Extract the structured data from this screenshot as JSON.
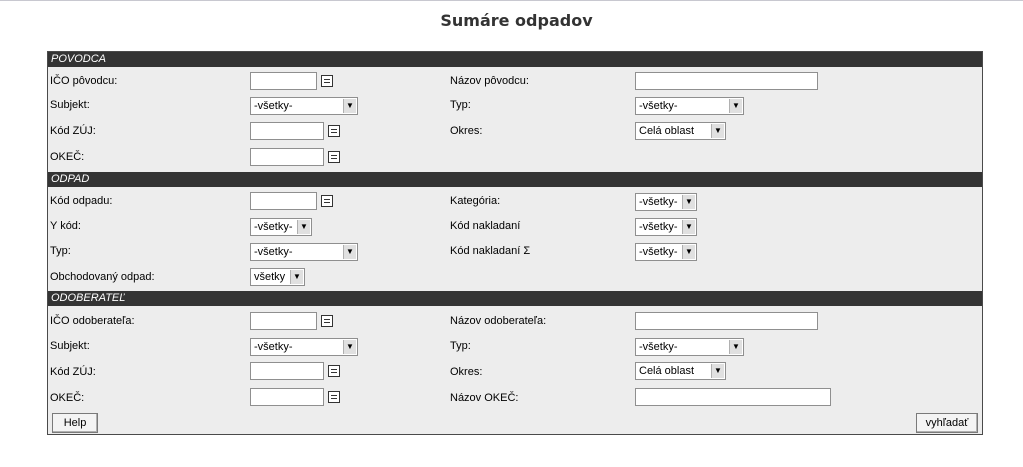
{
  "title": "Sumáre odpadov",
  "povodca": {
    "header": "POVODCA",
    "ico_label": "IČO pôvodcu:",
    "nazov_label": "Názov pôvodcu:",
    "subjekt_label": "Subjekt:",
    "subjekt_value": "-všetky-",
    "typ_label": "Typ:",
    "typ_value": "-všetky-",
    "kodzuj_label": "Kód ZÚJ:",
    "okres_label": "Okres:",
    "okres_value": "Celá oblast",
    "okec_label": "OKEČ:"
  },
  "odpad": {
    "header": "ODPAD",
    "kod_label": "Kód odpadu:",
    "kategoria_label": "Kategória:",
    "kategoria_value": "-všetky-",
    "ykod_label": "Y kód:",
    "ykod_value": "-všetky-",
    "nakladani_label": "Kód nakladaní",
    "nakladani_value": "-všetky-",
    "typ_label": "Typ:",
    "typ_value": "-všetky-",
    "nakladani_sum_label": "Kód nakladaní Σ",
    "nakladani_sum_value": "-všetky-",
    "obchod_label": "Obchodovaný odpad:",
    "obchod_value": "všetky"
  },
  "odoberatel": {
    "header": "ODOBERATEĽ",
    "ico_label": "IČO odoberateľa:",
    "nazov_label": "Názov odoberateľa:",
    "subjekt_label": "Subjekt:",
    "subjekt_value": "-všetky-",
    "typ_label": "Typ:",
    "typ_value": "-všetky-",
    "kodzuj_label": "Kód ZÚJ:",
    "okres_label": "Okres:",
    "okres_value": "Celá oblast",
    "okec_label": "OKEČ:",
    "nazov_okec_label": "Názov OKEČ:"
  },
  "buttons": {
    "help": "Help",
    "search": "vyhľadať"
  }
}
